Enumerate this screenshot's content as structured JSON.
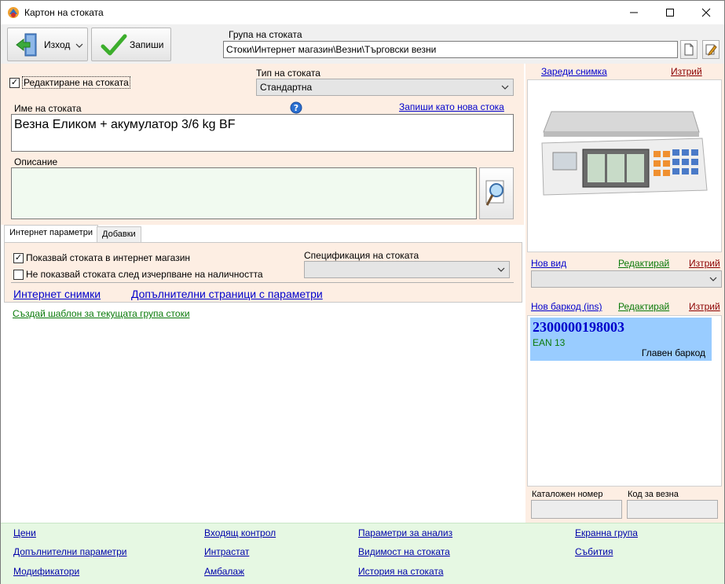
{
  "window": {
    "title": "Картон на стоката"
  },
  "toolbar": {
    "exit_label": "Изход",
    "save_label": "Запиши"
  },
  "group": {
    "label": "Група на стоката",
    "value": "Стоки\\Интернет магазин\\Везни\\Търговски везни"
  },
  "edit": {
    "edit_checkbox_label": "Редактиране на стоката",
    "edit_checked": true,
    "type_label": "Тип на стоката",
    "type_value": "Стандартна",
    "name_label": "Име на стоката",
    "save_as_new_link": "Запиши като нова стока",
    "name_value": "Везна Еликом + акумулатор 3/6 kg BF",
    "description_label": "Описание",
    "description_value": ""
  },
  "tabs": [
    {
      "label": "Интернет параметри",
      "active": true
    },
    {
      "label": "Добавки",
      "active": false
    }
  ],
  "internet": {
    "show_in_shop_label": "Показвай стоката в интернет магазин",
    "show_in_shop_checked": true,
    "hide_when_out_label": "Не показвай стоката след изчерпване на наличността",
    "hide_when_out_checked": false,
    "spec_label": "Спецификация на стоката",
    "spec_value": "",
    "internet_images_link": "Интернет снимки",
    "extra_pages_link": "Допълнителни страници с параметри"
  },
  "template_link": "Създай шаблон за текущата група стоки",
  "image": {
    "load_link": "Зареди снимка",
    "delete_link": "Изтрий"
  },
  "view": {
    "new_link": "Нов вид",
    "edit_link": "Редактирай",
    "delete_link": "Изтрий",
    "value": ""
  },
  "barcode": {
    "new_link": "Нов баркод (ins)",
    "edit_link": "Редактирай",
    "delete_link": "Изтрий",
    "items": [
      {
        "code": "2300000198003",
        "type": "EAN 13",
        "note": "Главен баркод"
      }
    ]
  },
  "catalog": {
    "catalog_label": "Каталожен номер",
    "catalog_value": "",
    "scale_code_label": "Код за везна",
    "scale_code_value": ""
  },
  "bottom_links": {
    "prices": "Цени",
    "extra_params": "Допълнителни параметри",
    "modifiers": "Модификатори",
    "incoming_control": "Входящ контрол",
    "intrastat": "Интрастат",
    "packaging": "Амбалаж",
    "analysis_params": "Параметри за анализ",
    "visibility": "Видимост на стоката",
    "history": "История на стоката",
    "screen_group": "Екранна група",
    "events": "Събития"
  },
  "colors": {
    "edit_bg": "#fdeee3",
    "bottom_bg": "#e6f8e3",
    "barcode_highlight": "#99ccff",
    "barcode_text": "#0000cc",
    "barcode_type_text": "#0a7a0a"
  }
}
